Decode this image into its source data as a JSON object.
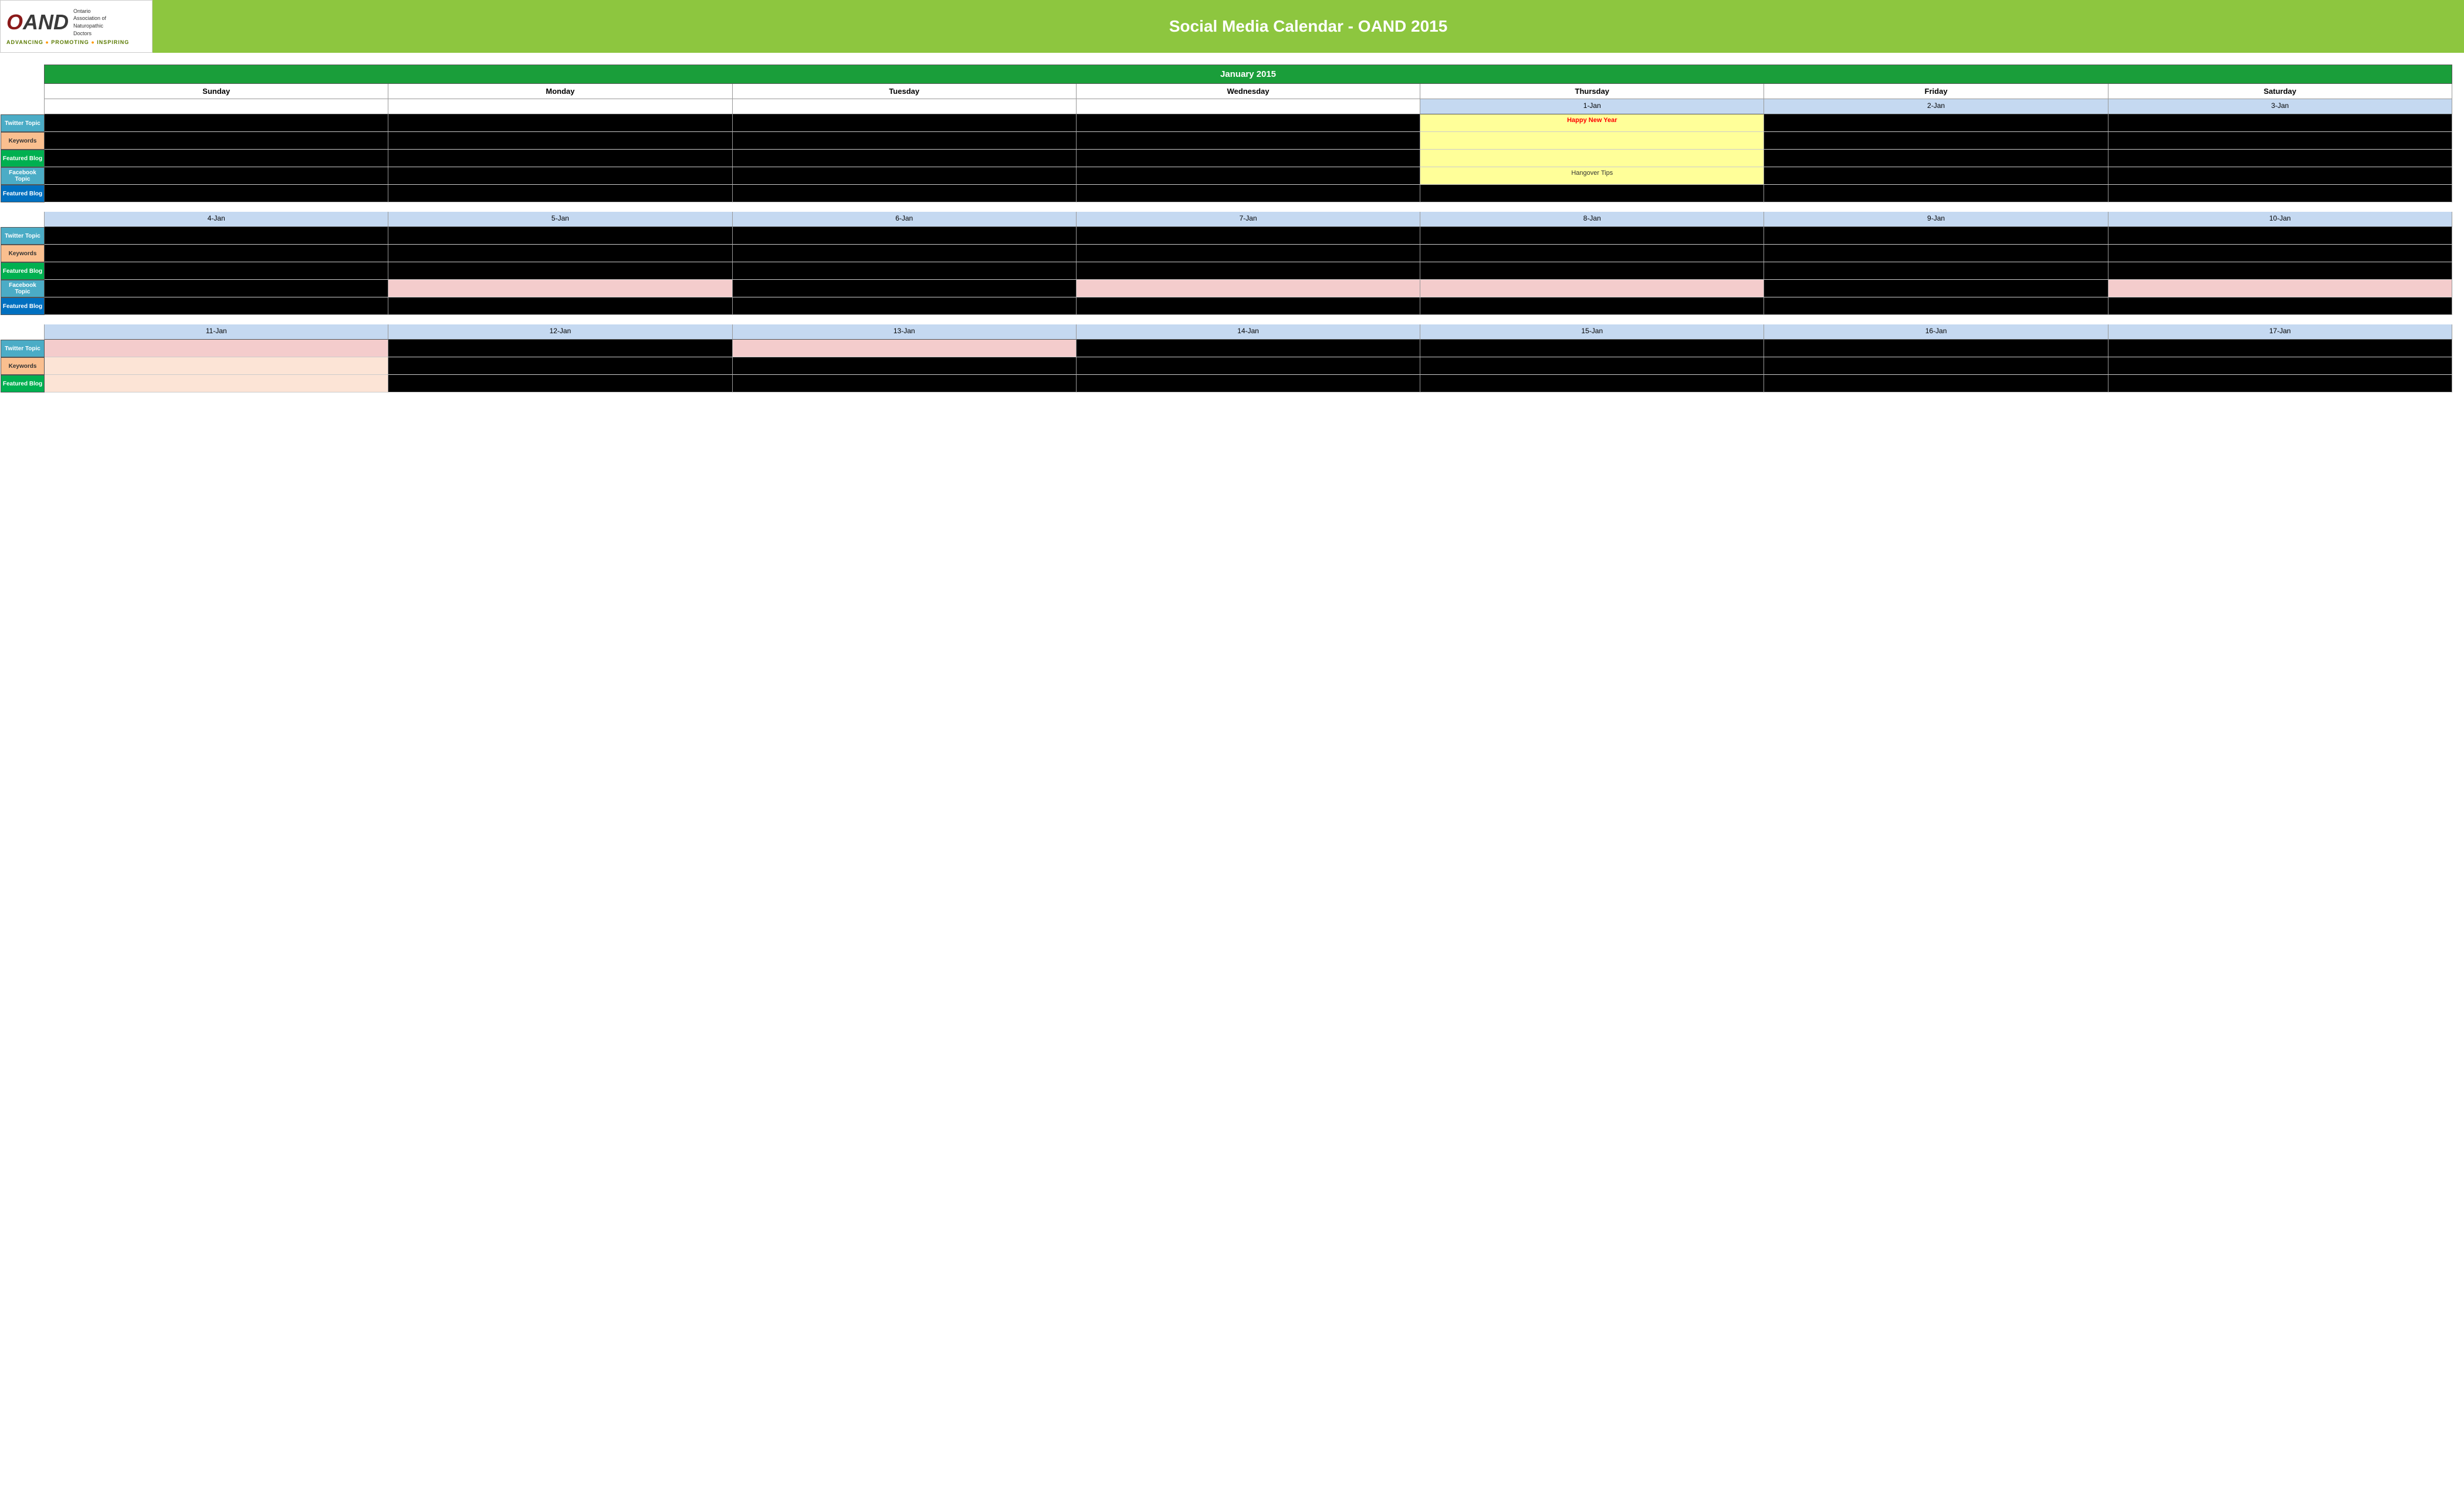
{
  "header": {
    "logo_o": "O",
    "logo_and": "AND",
    "logo_org_name": "Ontario\nAssociation of\nNaturopathic\nDoctors",
    "tagline": "ADVANCING • PROMOTING • INSPIRING",
    "title": "Social Media Calendar - OAND 2015"
  },
  "calendar": {
    "month": "January 2015",
    "days": [
      "Sunday",
      "Monday",
      "Tuesday",
      "Wednesday",
      "Thursday",
      "Friday",
      "Saturday"
    ],
    "row_labels": {
      "twitter": "Twitter Topic",
      "keywords": "Keywords",
      "featured": "Featured Blog",
      "facebook": "Facebook Topic",
      "featured_blog": "Featured Blog"
    },
    "weeks": [
      {
        "dates": [
          "",
          "",
          "",
          "",
          "1-Jan",
          "2-Jan",
          "3-Jan"
        ],
        "twitter": [
          "black",
          "black",
          "black",
          "black",
          "yellow",
          "black",
          "black"
        ],
        "twitter_text": [
          "",
          "",
          "",
          "",
          "Happy New Year",
          "",
          ""
        ],
        "keywords": [
          "black",
          "black",
          "black",
          "black",
          "yellow",
          "black",
          "black"
        ],
        "featured": [
          "black",
          "black",
          "black",
          "black",
          "yellow",
          "black",
          "black"
        ],
        "facebook": [
          "black",
          "black",
          "black",
          "black",
          "yellow",
          "black",
          "black"
        ],
        "facebook_text": [
          "",
          "",
          "",
          "",
          "Hangover Tips",
          "",
          ""
        ],
        "featured_blog": [
          "black",
          "black",
          "black",
          "black",
          "black",
          "black",
          "black"
        ]
      },
      {
        "dates": [
          "4-Jan",
          "5-Jan",
          "6-Jan",
          "7-Jan",
          "8-Jan",
          "9-Jan",
          "10-Jan"
        ],
        "twitter": [
          "black",
          "black",
          "black",
          "black",
          "black",
          "black",
          "black"
        ],
        "keywords": [
          "black",
          "black",
          "black",
          "black",
          "black",
          "black",
          "black"
        ],
        "featured": [
          "black",
          "black",
          "black",
          "black",
          "black",
          "black",
          "black"
        ],
        "facebook": [
          "black",
          "light-pink",
          "black",
          "light-pink",
          "light-pink",
          "black",
          "light-pink"
        ],
        "facebook_text": [
          "",
          "",
          "",
          "",
          "",
          "",
          ""
        ],
        "featured_blog": [
          "black",
          "black",
          "black",
          "black",
          "black",
          "black",
          "black"
        ]
      },
      {
        "dates": [
          "11-Jan",
          "12-Jan",
          "13-Jan",
          "14-Jan",
          "15-Jan",
          "16-Jan",
          "17-Jan"
        ],
        "twitter": [
          "light-pink",
          "black",
          "light-pink",
          "black",
          "black",
          "black",
          "black"
        ],
        "keywords": [
          "peach",
          "black",
          "black",
          "black",
          "black",
          "black",
          "black"
        ],
        "featured": [
          "peach",
          "black",
          "black",
          "black",
          "black",
          "black",
          "black"
        ],
        "facebook": [
          "black",
          "black",
          "black",
          "black",
          "black",
          "black",
          "black"
        ],
        "facebook_text": [
          "",
          "",
          "",
          "",
          "",
          "",
          ""
        ],
        "featured_blog": [
          "black",
          "black",
          "black",
          "black",
          "black",
          "black",
          "black"
        ]
      }
    ]
  }
}
